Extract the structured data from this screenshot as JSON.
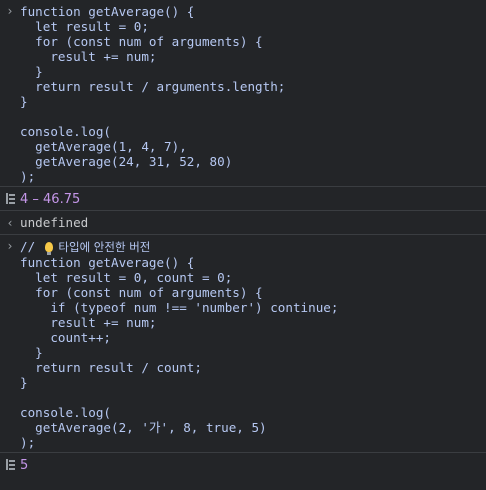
{
  "entries": [
    {
      "type": "input",
      "lines": [
        "function getAverage() {",
        "  let result = 0;",
        "  for (const num of arguments) {",
        "    result += num;",
        "  }",
        "  return result / arguments.length;",
        "}",
        "",
        "console.log(",
        "  getAverage(1, 4, 7),",
        "  getAverage(24, 31, 52, 80)",
        ");"
      ]
    },
    {
      "type": "log",
      "text": "4 – 46.75"
    },
    {
      "type": "return",
      "text": "undefined"
    },
    {
      "type": "input",
      "comment_prefix": "// ",
      "comment_text": " 타입에 안전한 버전",
      "lines": [
        "function getAverage() {",
        "  let result = 0, count = 0;",
        "  for (const num of arguments) {",
        "    if (typeof num !== 'number') continue;",
        "    result += num;",
        "    count++;",
        "  }",
        "  return result / count;",
        "}",
        "",
        "console.log(",
        "  getAverage(2, '가', 8, true, 5)",
        ");"
      ]
    },
    {
      "type": "log",
      "text": "5"
    }
  ],
  "icons": {
    "input_prompt": "chevron-right-icon",
    "log_output": "console-log-icon",
    "return_value": "return-arrow-icon",
    "bulb": "lightbulb-icon"
  },
  "colors": {
    "background": "#232528",
    "code": "#b6c8f2",
    "result": "#c496e8",
    "divider": "#3a3d41"
  }
}
